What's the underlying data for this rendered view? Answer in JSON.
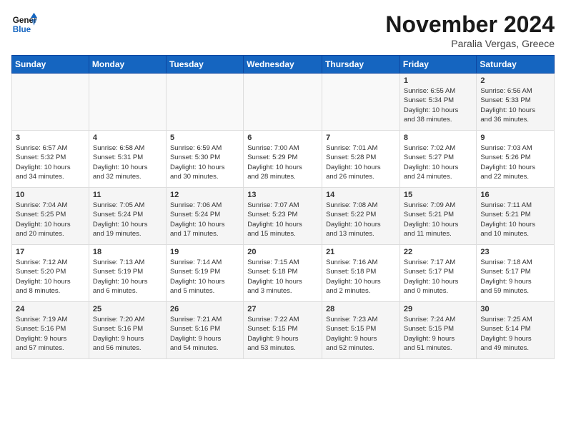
{
  "header": {
    "logo_line1": "General",
    "logo_line2": "Blue",
    "month": "November 2024",
    "location": "Paralia Vergas, Greece"
  },
  "weekdays": [
    "Sunday",
    "Monday",
    "Tuesday",
    "Wednesday",
    "Thursday",
    "Friday",
    "Saturday"
  ],
  "weeks": [
    [
      {
        "day": "",
        "info": ""
      },
      {
        "day": "",
        "info": ""
      },
      {
        "day": "",
        "info": ""
      },
      {
        "day": "",
        "info": ""
      },
      {
        "day": "",
        "info": ""
      },
      {
        "day": "1",
        "info": "Sunrise: 6:55 AM\nSunset: 5:34 PM\nDaylight: 10 hours\nand 38 minutes."
      },
      {
        "day": "2",
        "info": "Sunrise: 6:56 AM\nSunset: 5:33 PM\nDaylight: 10 hours\nand 36 minutes."
      }
    ],
    [
      {
        "day": "3",
        "info": "Sunrise: 6:57 AM\nSunset: 5:32 PM\nDaylight: 10 hours\nand 34 minutes."
      },
      {
        "day": "4",
        "info": "Sunrise: 6:58 AM\nSunset: 5:31 PM\nDaylight: 10 hours\nand 32 minutes."
      },
      {
        "day": "5",
        "info": "Sunrise: 6:59 AM\nSunset: 5:30 PM\nDaylight: 10 hours\nand 30 minutes."
      },
      {
        "day": "6",
        "info": "Sunrise: 7:00 AM\nSunset: 5:29 PM\nDaylight: 10 hours\nand 28 minutes."
      },
      {
        "day": "7",
        "info": "Sunrise: 7:01 AM\nSunset: 5:28 PM\nDaylight: 10 hours\nand 26 minutes."
      },
      {
        "day": "8",
        "info": "Sunrise: 7:02 AM\nSunset: 5:27 PM\nDaylight: 10 hours\nand 24 minutes."
      },
      {
        "day": "9",
        "info": "Sunrise: 7:03 AM\nSunset: 5:26 PM\nDaylight: 10 hours\nand 22 minutes."
      }
    ],
    [
      {
        "day": "10",
        "info": "Sunrise: 7:04 AM\nSunset: 5:25 PM\nDaylight: 10 hours\nand 20 minutes."
      },
      {
        "day": "11",
        "info": "Sunrise: 7:05 AM\nSunset: 5:24 PM\nDaylight: 10 hours\nand 19 minutes."
      },
      {
        "day": "12",
        "info": "Sunrise: 7:06 AM\nSunset: 5:24 PM\nDaylight: 10 hours\nand 17 minutes."
      },
      {
        "day": "13",
        "info": "Sunrise: 7:07 AM\nSunset: 5:23 PM\nDaylight: 10 hours\nand 15 minutes."
      },
      {
        "day": "14",
        "info": "Sunrise: 7:08 AM\nSunset: 5:22 PM\nDaylight: 10 hours\nand 13 minutes."
      },
      {
        "day": "15",
        "info": "Sunrise: 7:09 AM\nSunset: 5:21 PM\nDaylight: 10 hours\nand 11 minutes."
      },
      {
        "day": "16",
        "info": "Sunrise: 7:11 AM\nSunset: 5:21 PM\nDaylight: 10 hours\nand 10 minutes."
      }
    ],
    [
      {
        "day": "17",
        "info": "Sunrise: 7:12 AM\nSunset: 5:20 PM\nDaylight: 10 hours\nand 8 minutes."
      },
      {
        "day": "18",
        "info": "Sunrise: 7:13 AM\nSunset: 5:19 PM\nDaylight: 10 hours\nand 6 minutes."
      },
      {
        "day": "19",
        "info": "Sunrise: 7:14 AM\nSunset: 5:19 PM\nDaylight: 10 hours\nand 5 minutes."
      },
      {
        "day": "20",
        "info": "Sunrise: 7:15 AM\nSunset: 5:18 PM\nDaylight: 10 hours\nand 3 minutes."
      },
      {
        "day": "21",
        "info": "Sunrise: 7:16 AM\nSunset: 5:18 PM\nDaylight: 10 hours\nand 2 minutes."
      },
      {
        "day": "22",
        "info": "Sunrise: 7:17 AM\nSunset: 5:17 PM\nDaylight: 10 hours\nand 0 minutes."
      },
      {
        "day": "23",
        "info": "Sunrise: 7:18 AM\nSunset: 5:17 PM\nDaylight: 9 hours\nand 59 minutes."
      }
    ],
    [
      {
        "day": "24",
        "info": "Sunrise: 7:19 AM\nSunset: 5:16 PM\nDaylight: 9 hours\nand 57 minutes."
      },
      {
        "day": "25",
        "info": "Sunrise: 7:20 AM\nSunset: 5:16 PM\nDaylight: 9 hours\nand 56 minutes."
      },
      {
        "day": "26",
        "info": "Sunrise: 7:21 AM\nSunset: 5:16 PM\nDaylight: 9 hours\nand 54 minutes."
      },
      {
        "day": "27",
        "info": "Sunrise: 7:22 AM\nSunset: 5:15 PM\nDaylight: 9 hours\nand 53 minutes."
      },
      {
        "day": "28",
        "info": "Sunrise: 7:23 AM\nSunset: 5:15 PM\nDaylight: 9 hours\nand 52 minutes."
      },
      {
        "day": "29",
        "info": "Sunrise: 7:24 AM\nSunset: 5:15 PM\nDaylight: 9 hours\nand 51 minutes."
      },
      {
        "day": "30",
        "info": "Sunrise: 7:25 AM\nSunset: 5:14 PM\nDaylight: 9 hours\nand 49 minutes."
      }
    ]
  ]
}
